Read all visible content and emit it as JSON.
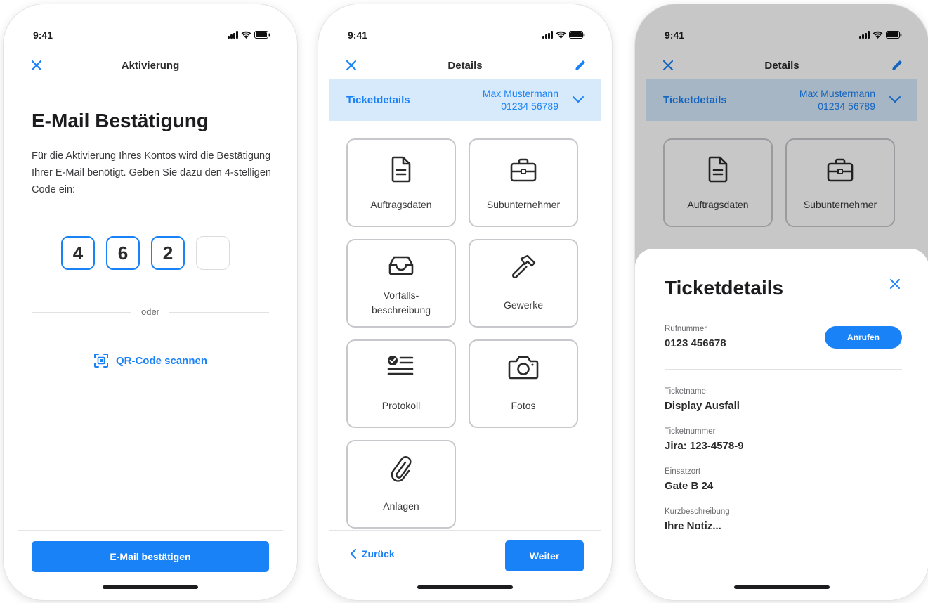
{
  "colors": {
    "accent": "#1a82f7",
    "highlight_bg": "#d6eafb",
    "tile_border": "#c7c7cc"
  },
  "status_bar": {
    "time": "9:41"
  },
  "activation_screen": {
    "nav_title": "Aktivierung",
    "heading": "E-Mail Bestätigung",
    "description": "Für die Aktivierung Ihres Kontos wird die Bestätigung Ihrer E-Mail benötigt. Geben Sie dazu den 4-stelligen Code ein:",
    "code_digits": [
      "4",
      "6",
      "2",
      ""
    ],
    "divider_text": "oder",
    "qr_link_label": "QR-Code scannen",
    "confirm_button": "E-Mail bestätigen"
  },
  "details_screen": {
    "nav_title": "Details",
    "ticket_bar": {
      "title": "Ticketdetails",
      "contact_name": "Max Mustermann",
      "contact_phone": "01234 56789"
    },
    "tiles": [
      {
        "label": "Auftragsdaten",
        "icon": "document-icon"
      },
      {
        "label": "Subunternehmer",
        "icon": "briefcase-icon"
      },
      {
        "label": "Vorfalls-\nbeschreibung",
        "icon": "inbox-icon"
      },
      {
        "label": "Gewerke",
        "icon": "hammer-icon"
      },
      {
        "label": "Protokoll",
        "icon": "checklist-icon"
      },
      {
        "label": "Fotos",
        "icon": "camera-icon"
      },
      {
        "label": "Anlagen",
        "icon": "paperclip-icon"
      }
    ],
    "back_button": "Zurück",
    "next_button": "Weiter"
  },
  "ticket_sheet": {
    "title": "Ticketdetails",
    "phone_label": "Rufnummer",
    "phone_value": "0123 456678",
    "call_button": "Anrufen",
    "fields": [
      {
        "label": "Ticketname",
        "value": "Display Ausfall"
      },
      {
        "label": "Ticketnummer",
        "value": "Jira: 123-4578-9"
      },
      {
        "label": "Einsatzort",
        "value": "Gate B 24"
      },
      {
        "label": "Kurzbeschreibung",
        "value": "Ihre Notiz..."
      }
    ]
  }
}
